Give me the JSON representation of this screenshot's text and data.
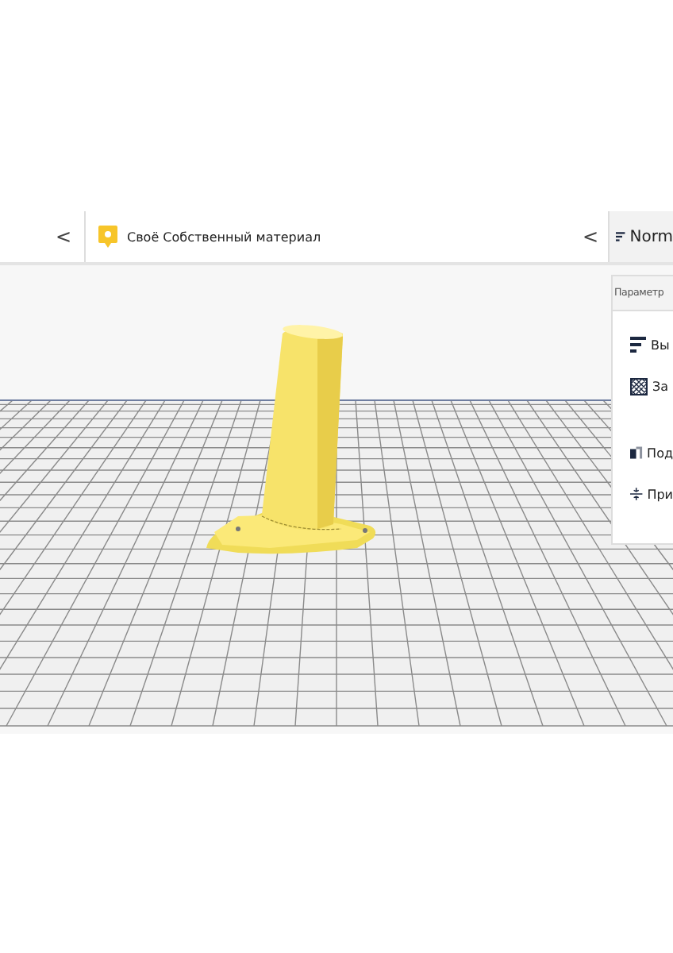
{
  "toolbar": {
    "collapse_left": "<",
    "material_name": "Своё Собственный материал",
    "collapse_right": "<",
    "profile": "Norm"
  },
  "settings_panel": {
    "title": "Параметр",
    "items": [
      {
        "kind": "layer",
        "label": "Вы"
      },
      {
        "kind": "infill",
        "label": "За"
      },
      {
        "kind": "support",
        "label": "Под"
      },
      {
        "kind": "adhesion",
        "label": "При"
      }
    ]
  }
}
